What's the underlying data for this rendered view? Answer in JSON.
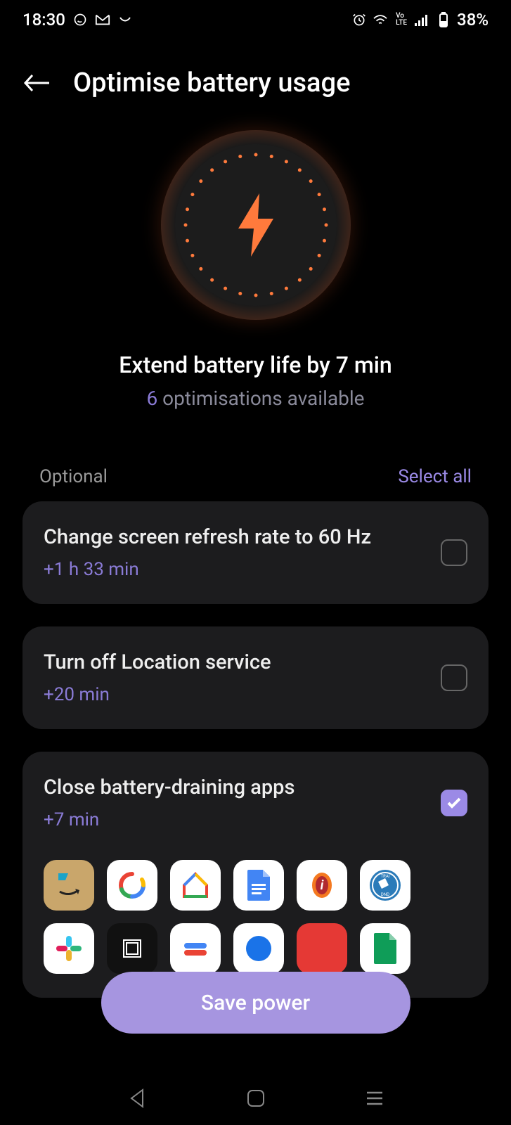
{
  "status": {
    "time": "18:30",
    "battery_pct": "38%"
  },
  "header": {
    "title": "Optimise battery usage"
  },
  "hero": {
    "headline": "Extend battery life by 7 min",
    "sub_count": "6",
    "sub_text": " optimisations available"
  },
  "section": {
    "label": "Optional",
    "select_all": "Select all"
  },
  "cards": [
    {
      "title": "Change screen refresh rate to 60 Hz",
      "sub": "+1 h 33 min",
      "checked": false
    },
    {
      "title": "Turn off Location service",
      "sub": "+20 min",
      "checked": false
    },
    {
      "title": "Close battery-draining apps",
      "sub": "+7 min",
      "checked": true
    }
  ],
  "save_button": "Save power"
}
